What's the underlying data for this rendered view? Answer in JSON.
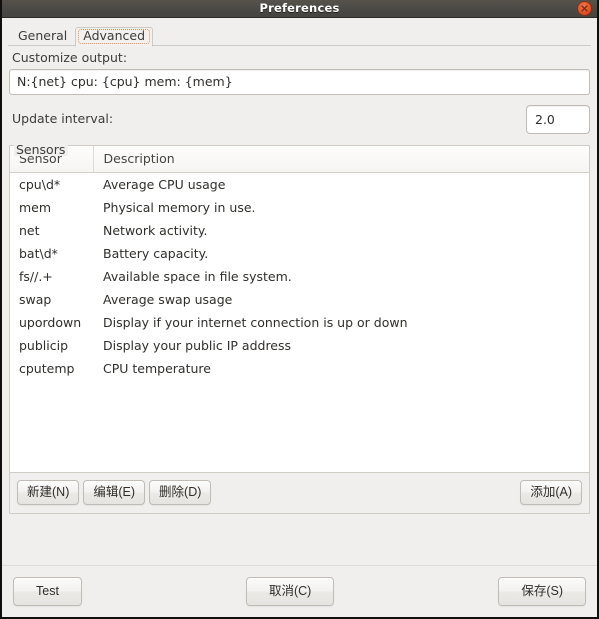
{
  "window": {
    "title": "Preferences",
    "close_icon": "close-icon"
  },
  "tabs": [
    {
      "label": "General",
      "selected": false
    },
    {
      "label": "Advanced",
      "selected": true
    }
  ],
  "advanced": {
    "customize_output_label": "Customize output:",
    "customize_output_value": "N:{net} cpu: {cpu} mem: {mem}",
    "customize_output_placeholder": "",
    "update_interval_label": "Update interval:",
    "update_interval_value": "2.0",
    "sensors_legend": "Sensors",
    "columns": [
      "Sensor",
      "Description"
    ],
    "rows": [
      {
        "sensor": "cpu\\d*",
        "description": "Average CPU usage"
      },
      {
        "sensor": "mem",
        "description": "Physical memory in use."
      },
      {
        "sensor": "net",
        "description": "Network activity."
      },
      {
        "sensor": "bat\\d*",
        "description": "Battery capacity."
      },
      {
        "sensor": "fs//.+",
        "description": "Available space in file system."
      },
      {
        "sensor": "swap",
        "description": "Average swap usage"
      },
      {
        "sensor": "upordown",
        "description": "Display if your internet connection is up or down"
      },
      {
        "sensor": "publicip",
        "description": "Display your public IP address"
      },
      {
        "sensor": "cputemp",
        "description": "CPU temperature"
      }
    ],
    "sensor_actions": {
      "new": "新建(N)",
      "edit": "编辑(E)",
      "delete": "删除(D)",
      "add": "添加(A)"
    }
  },
  "dialog_actions": {
    "test": "Test",
    "cancel": "取消(C)",
    "save": "保存(S)"
  },
  "colors": {
    "titlebar": "#4a4843",
    "close_button": "#e4562a",
    "panel_background": "#f0efee",
    "accent_focus": "#e98b52",
    "entry_background": "#ffffff",
    "border": "#cfccc6"
  }
}
